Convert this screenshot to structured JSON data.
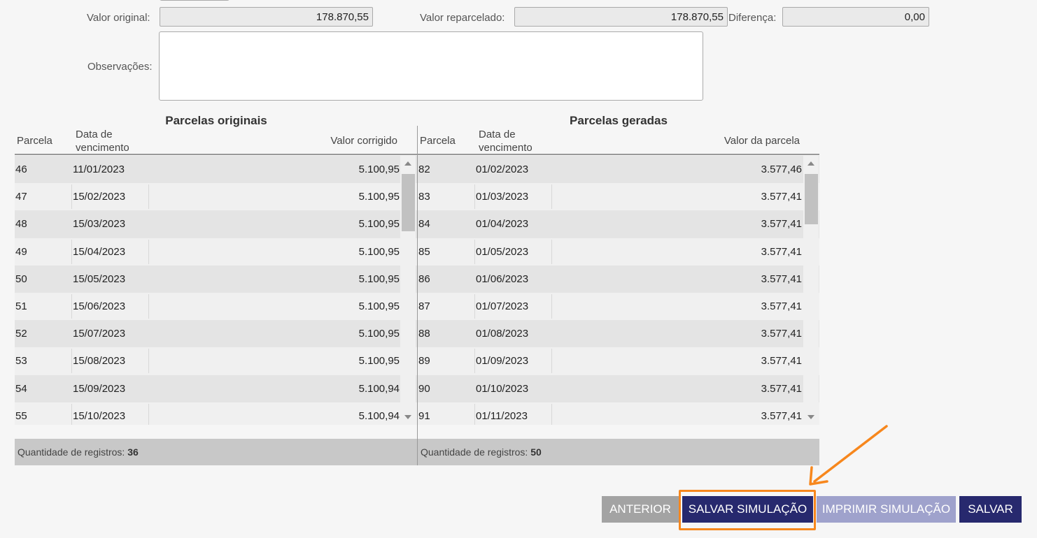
{
  "form": {
    "valor_original_label": "Valor original:",
    "valor_original": "178.870,55",
    "valor_reparcelado_label": "Valor reparcelado:",
    "valor_reparcelado": "178.870,55",
    "diferenca_label": "Diferença:",
    "diferenca": "0,00",
    "observacoes_label": "Observações:",
    "observacoes": ""
  },
  "originais": {
    "title": "Parcelas originais",
    "col_parcela": "Parcela",
    "col_data_1": "Data de",
    "col_data_2": "vencimento",
    "col_valor": "Valor corrigido",
    "rows": [
      {
        "parcela": "46",
        "data": "11/01/2023",
        "valor": "5.100,95"
      },
      {
        "parcela": "47",
        "data": "15/02/2023",
        "valor": "5.100,95"
      },
      {
        "parcela": "48",
        "data": "15/03/2023",
        "valor": "5.100,95"
      },
      {
        "parcela": "49",
        "data": "15/04/2023",
        "valor": "5.100,95"
      },
      {
        "parcela": "50",
        "data": "15/05/2023",
        "valor": "5.100,95"
      },
      {
        "parcela": "51",
        "data": "15/06/2023",
        "valor": "5.100,95"
      },
      {
        "parcela": "52",
        "data": "15/07/2023",
        "valor": "5.100,95"
      },
      {
        "parcela": "53",
        "data": "15/08/2023",
        "valor": "5.100,95"
      },
      {
        "parcela": "54",
        "data": "15/09/2023",
        "valor": "5.100,94"
      },
      {
        "parcela": "55",
        "data": "15/10/2023",
        "valor": "5.100,94"
      }
    ],
    "footer_label": "Quantidade de registros:",
    "footer_count": "36"
  },
  "geradas": {
    "title": "Parcelas geradas",
    "col_parcela": "Parcela",
    "col_data_1": "Data de",
    "col_data_2": "vencimento",
    "col_valor": "Valor da parcela",
    "rows": [
      {
        "parcela": "82",
        "data": "01/02/2023",
        "valor": "3.577,46"
      },
      {
        "parcela": "83",
        "data": "01/03/2023",
        "valor": "3.577,41"
      },
      {
        "parcela": "84",
        "data": "01/04/2023",
        "valor": "3.577,41"
      },
      {
        "parcela": "85",
        "data": "01/05/2023",
        "valor": "3.577,41"
      },
      {
        "parcela": "86",
        "data": "01/06/2023",
        "valor": "3.577,41"
      },
      {
        "parcela": "87",
        "data": "01/07/2023",
        "valor": "3.577,41"
      },
      {
        "parcela": "88",
        "data": "01/08/2023",
        "valor": "3.577,41"
      },
      {
        "parcela": "89",
        "data": "01/09/2023",
        "valor": "3.577,41"
      },
      {
        "parcela": "90",
        "data": "01/10/2023",
        "valor": "3.577,41"
      },
      {
        "parcela": "91",
        "data": "01/11/2023",
        "valor": "3.577,41"
      }
    ],
    "footer_label": "Quantidade de registros:",
    "footer_count": "50"
  },
  "buttons": {
    "anterior": "ANTERIOR",
    "salvar_simulacao": "SALVAR SIMULAÇÃO",
    "imprimir_simulacao": "IMPRIMIR SIMULAÇÃO",
    "salvar": "SALVAR"
  },
  "colors": {
    "primary": "#27296e",
    "disabled_primary": "#9fa2cc",
    "secondary": "#a3a3a3",
    "highlight": "#f7871d"
  }
}
